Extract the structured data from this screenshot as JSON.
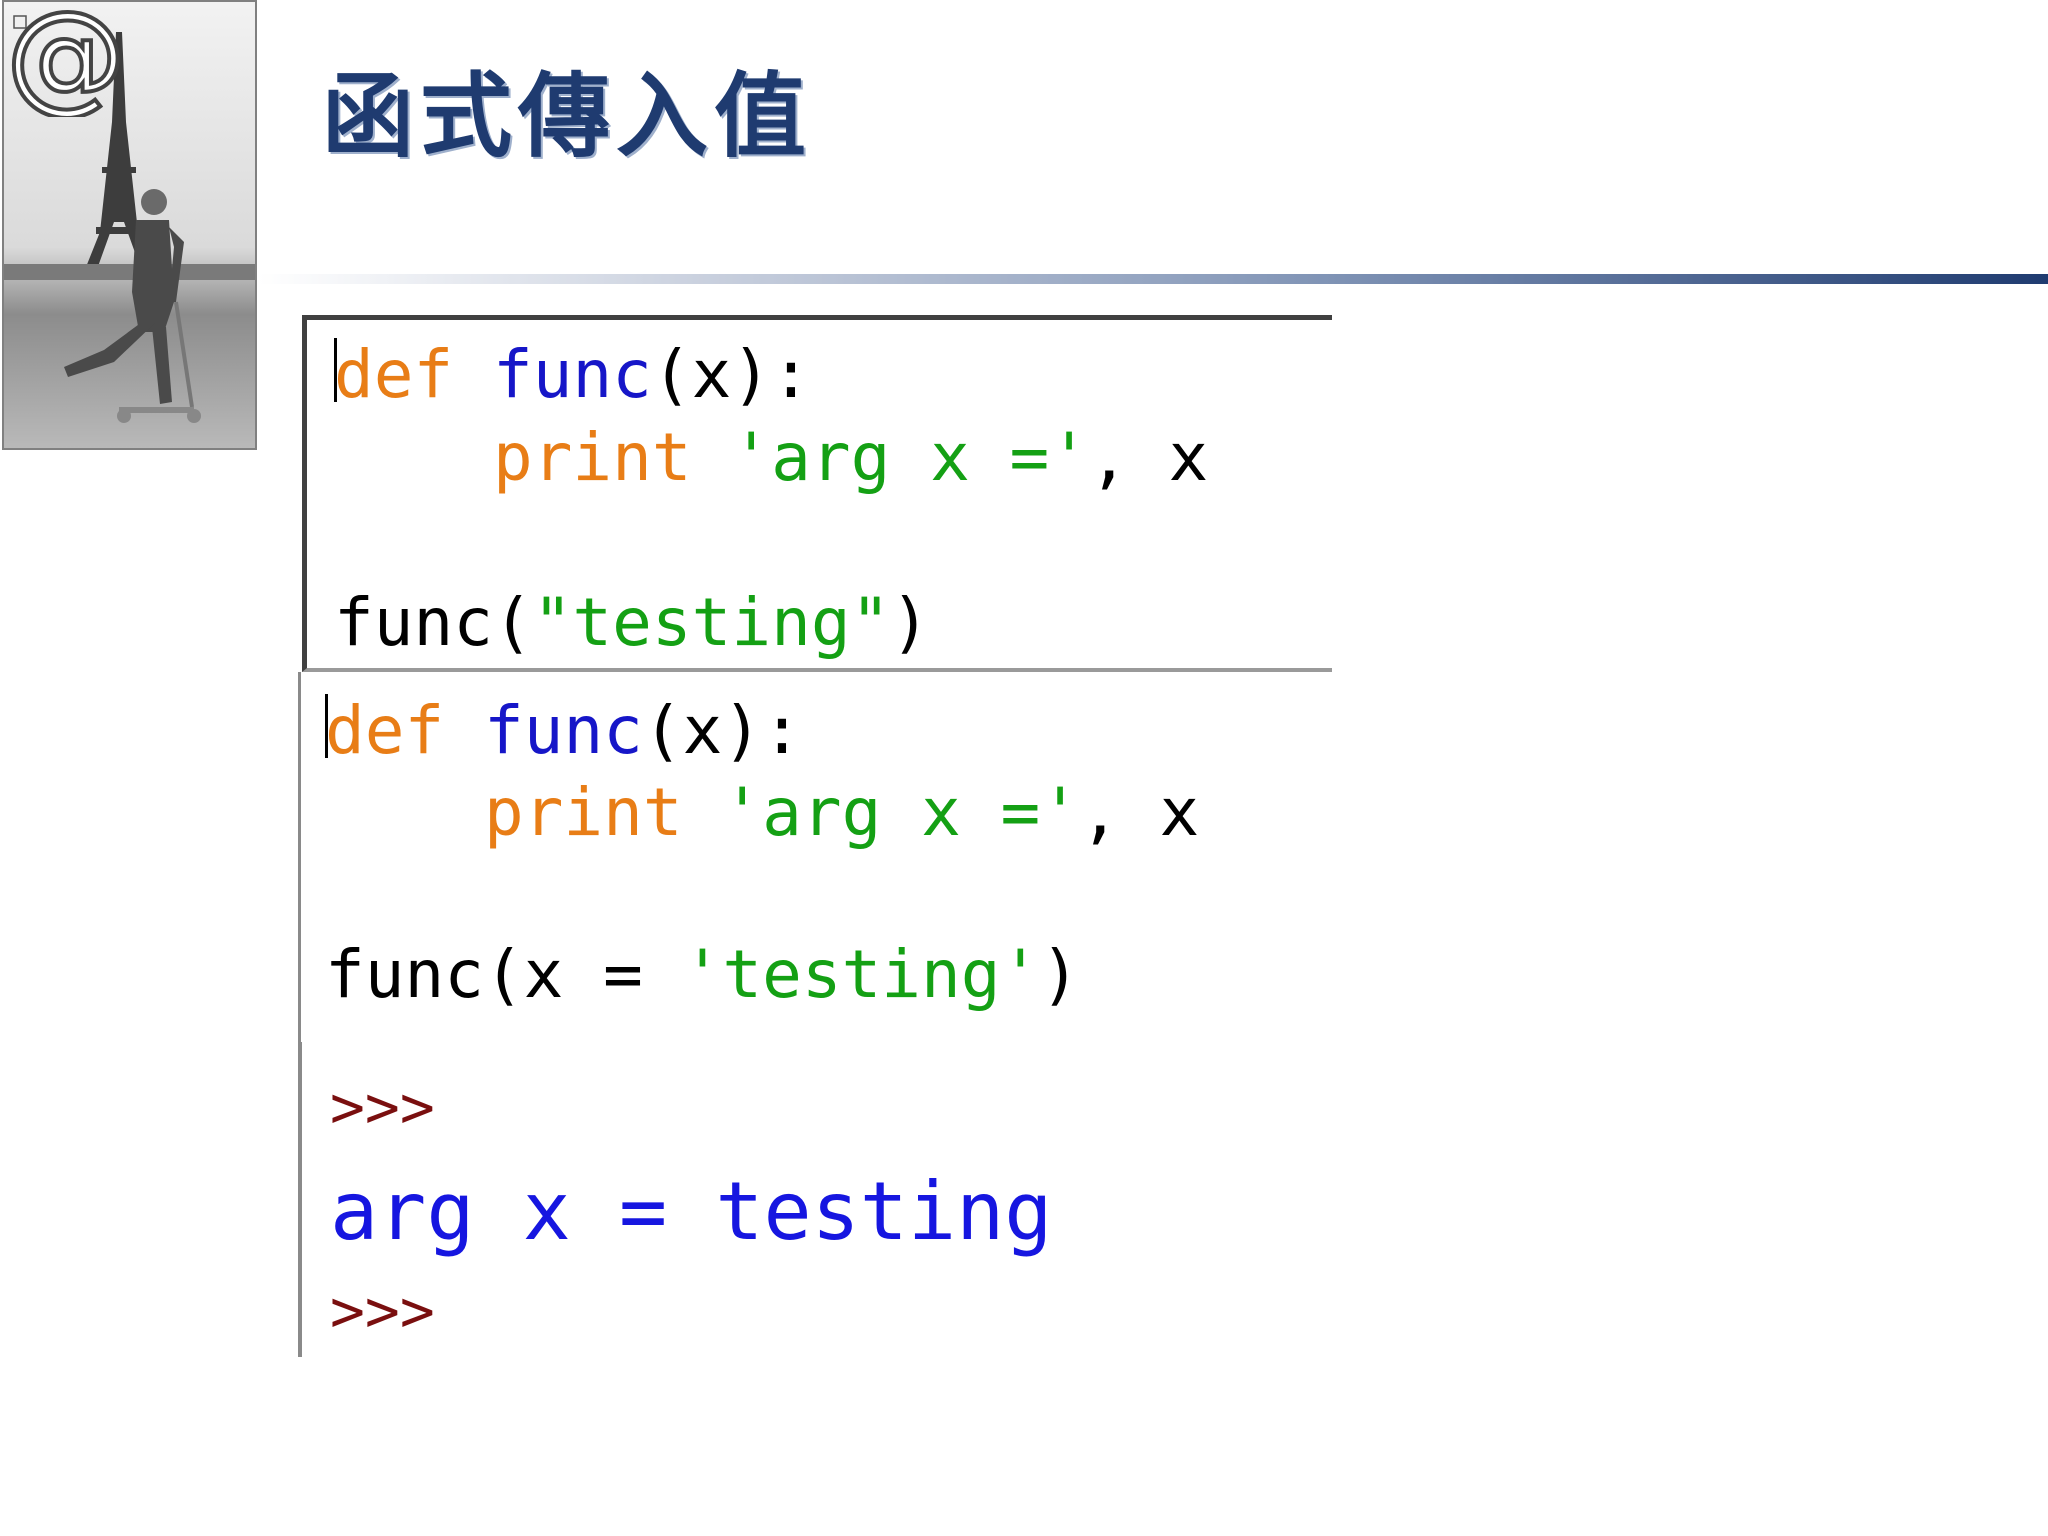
{
  "slide": {
    "title": "函式傳入值",
    "logo_text": "@",
    "colors": {
      "title": "#1f3b70",
      "keyword": "#e87d16",
      "function_name": "#1616c8",
      "string": "#14a014",
      "prompt": "#7a0f0f",
      "output": "#1616e0"
    }
  },
  "editor1": {
    "line1": {
      "kw": "def",
      "fn": "func",
      "rest": "(x):"
    },
    "line2": {
      "kw": "print",
      "str": "'arg x ='",
      "rest": ", x"
    },
    "line3": {
      "call": "func(",
      "str": "\"testing\"",
      "close": ")"
    }
  },
  "editor2": {
    "line1": {
      "kw": "def",
      "fn": "func",
      "rest": "(x):"
    },
    "line2": {
      "kw": "print",
      "str": "'arg x ='",
      "rest": ", x"
    },
    "line3": {
      "call": "func(x = ",
      "str": "'testing'",
      "close": ")"
    }
  },
  "shell": {
    "prompt1": ">>>",
    "output": "arg x = testing",
    "prompt2": ">>>"
  }
}
